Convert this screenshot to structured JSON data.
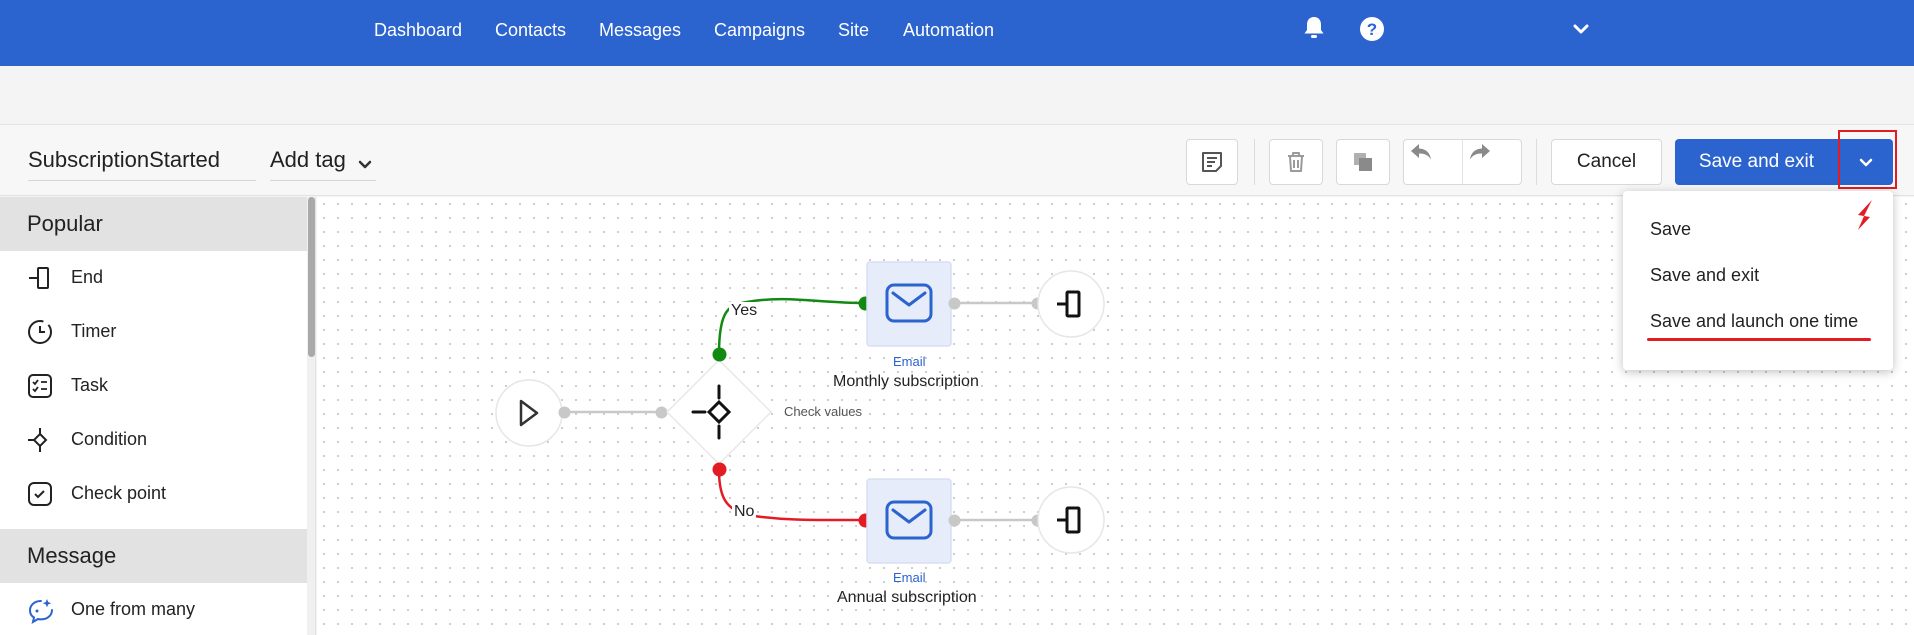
{
  "nav": {
    "links": [
      "Dashboard",
      "Contacts",
      "Messages",
      "Campaigns",
      "Site",
      "Automation"
    ],
    "icons": [
      "bell-icon",
      "help-icon",
      "chevron-down-icon"
    ]
  },
  "toolbar": {
    "workflow_name": "SubscriptionStarted",
    "add_tag_label": "Add tag",
    "cancel_label": "Cancel",
    "save_exit_label": "Save and exit"
  },
  "save_menu": {
    "items": [
      "Save",
      "Save and exit",
      "Save and launch one time"
    ]
  },
  "left_panel": {
    "sections": [
      {
        "title": "Popular",
        "items": [
          {
            "label": "End",
            "icon": "end-icon"
          },
          {
            "label": "Timer",
            "icon": "timer-icon"
          },
          {
            "label": "Task",
            "icon": "task-icon"
          },
          {
            "label": "Condition",
            "icon": "condition-icon"
          },
          {
            "label": "Check point",
            "icon": "check-point-icon"
          }
        ]
      },
      {
        "title": "Message",
        "items": [
          {
            "label": "One from many",
            "icon": "one-from-many-icon"
          }
        ]
      }
    ]
  },
  "canvas": {
    "condition_label": "Check values",
    "branch_yes": "Yes",
    "branch_no": "No",
    "email_type": "Email",
    "email_top_name": "Monthly subscription",
    "email_bottom_name": "Annual subscription"
  },
  "colors": {
    "brand": "#2b63cf",
    "yes_branch": "#128a12",
    "no_branch": "#e31b23",
    "highlight": "#e31b23"
  }
}
